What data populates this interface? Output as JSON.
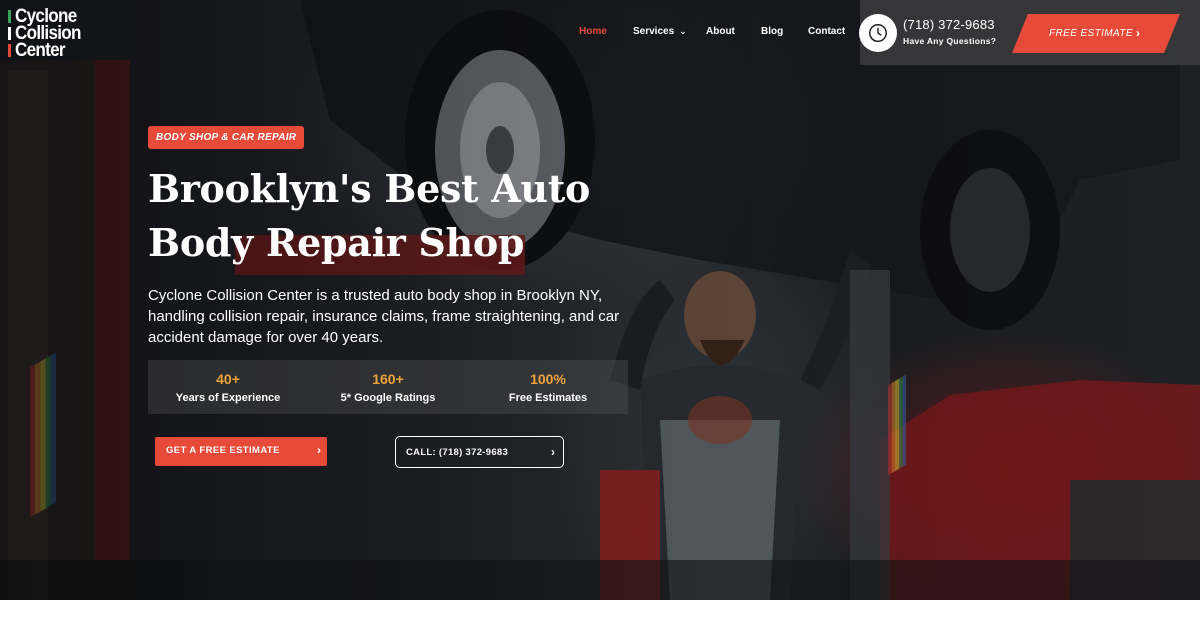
{
  "logo": {
    "lines": [
      "Cyclone",
      "Collision",
      "Center"
    ],
    "bar_colors": [
      "#3aa35a",
      "#ffffff",
      "#e84a3a"
    ]
  },
  "nav": {
    "items": [
      {
        "label": "Home",
        "active": true
      },
      {
        "label": "Services",
        "has_dropdown": true
      },
      {
        "label": "About"
      },
      {
        "label": "Blog"
      },
      {
        "label": "Contact"
      }
    ]
  },
  "contact": {
    "phone": "(718) 372-9683",
    "subtitle": "Have Any Questions?",
    "icon": "phone-clock-icon"
  },
  "header_cta": {
    "label": "FREE ESTIMATE",
    "icon": "chevron-right-icon"
  },
  "hero": {
    "tag": "BODY SHOP & CAR REPAIR",
    "headline_lines": [
      "Brooklyn's Best Auto",
      "Body Repair Shop"
    ],
    "description": "Cyclone Collision Center is a trusted auto body shop in Brooklyn NY, handling collision repair, insurance claims, frame straightening, and car accident damage for over 40 years.",
    "stats": [
      {
        "value": "40+",
        "label": "Years of Experience"
      },
      {
        "value": "160+",
        "label": "5* Google Ratings"
      },
      {
        "value": "100%",
        "label": "Free Estimates"
      }
    ],
    "cta_primary": "GET A FREE ESTIMATE",
    "cta_secondary": "CALL: (718) 372-9683",
    "background_image": "mechanic under lifted car in garage"
  },
  "colors": {
    "accent": "#e84a3a",
    "stat": "#f0a33a",
    "contact_bg": "#3a3a3c"
  }
}
